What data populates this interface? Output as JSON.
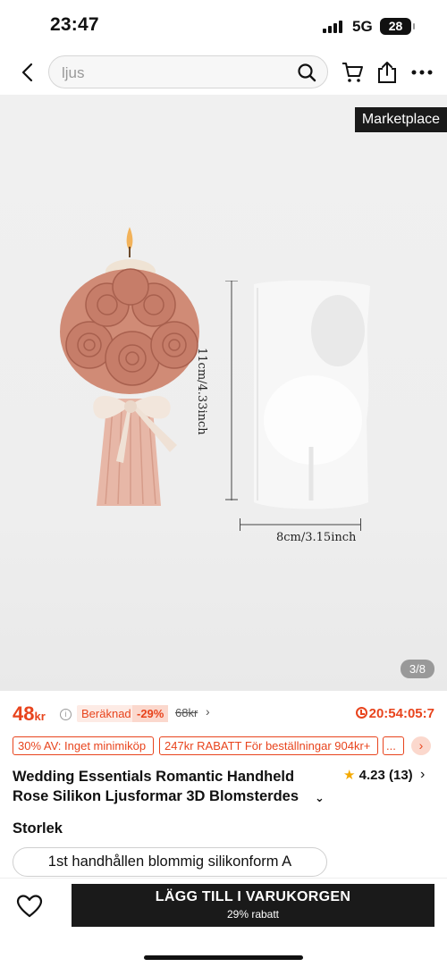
{
  "status_bar": {
    "time": "23:47",
    "network": "5G",
    "battery": "28"
  },
  "search": {
    "placeholder": "ljus"
  },
  "gallery": {
    "badge": "Marketplace",
    "counter": "3/8",
    "height_label": "11cm/4.33inch",
    "width_label": "8cm/3.15inch"
  },
  "price": {
    "amount": "48",
    "currency": "kr",
    "calc_label": "Beräknad",
    "discount": "-29%",
    "original": "68kr",
    "countdown": "20:54:05:7"
  },
  "coupons": [
    "30% AV: Inget minimiköp",
    "247kr RABATT För beställningar 904kr+",
    "..."
  ],
  "product": {
    "title_line1": "Wedding Essentials Romantic Handheld",
    "title_line2": "Rose Silikon Ljusformar 3D Blomsterdes",
    "rating": "4.23",
    "review_count": "(13)"
  },
  "size": {
    "label": "Storlek",
    "selected": "1st handhållen blommig silikonform A"
  },
  "bottom_bar": {
    "cta_label": "LÄGG TILL I VARUKORGEN",
    "cta_sub": "29% rabatt"
  },
  "colors": {
    "accent": "#e8441d",
    "cta": "#1a1a1a",
    "star": "#f4a900"
  }
}
